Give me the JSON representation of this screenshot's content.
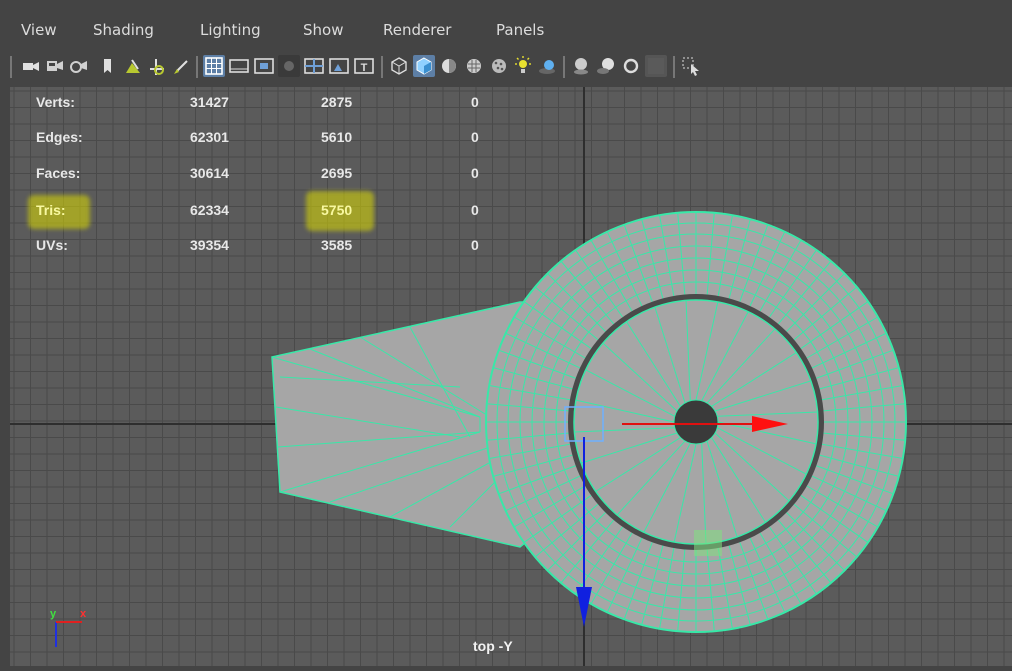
{
  "menu": {
    "items": [
      "View",
      "Shading",
      "Lighting",
      "Show",
      "Renderer",
      "Panels"
    ]
  },
  "stats": {
    "rows": [
      {
        "label": "Verts:",
        "total": "31427",
        "selected": "2875",
        "extra": "0"
      },
      {
        "label": "Edges:",
        "total": "62301",
        "selected": "5610",
        "extra": "0"
      },
      {
        "label": "Faces:",
        "total": "30614",
        "selected": "2695",
        "extra": "0"
      },
      {
        "label": "Tris:",
        "total": "62334",
        "selected": "5750",
        "extra": "0"
      },
      {
        "label": "UVs:",
        "total": "39354",
        "selected": "3585",
        "extra": "0"
      }
    ],
    "highlight_color": "#d8d800"
  },
  "viewport": {
    "camera_label": "top -Y",
    "axis": {
      "y_label": "y",
      "x_label": "x"
    },
    "background_color": "#5b5b5b",
    "wireframe_color": "#38e8a8",
    "mesh_color": "#a6a6a6"
  },
  "toolbar": {
    "icons": [
      "camera-icon",
      "camera-attributes-icon",
      "camera-lock-icon",
      "bookmark-icon",
      "image-plane-icon",
      "transform-icon",
      "paint-icon",
      "grid-icon",
      "film-gate-icon",
      "resolution-gate-icon",
      "gate-mask-icon",
      "field-chart-icon",
      "safe-action-icon",
      "safe-title-icon",
      "wireframe-icon",
      "smooth-shade-icon",
      "default-material-icon",
      "textured-icon",
      "use-lights-icon",
      "shadows-icon",
      "ambient-occlusion-icon",
      "motion-blur-icon",
      "anti-aliasing-icon",
      "depth-of-field-icon",
      "isolate-select-icon",
      "xray-icon"
    ]
  }
}
